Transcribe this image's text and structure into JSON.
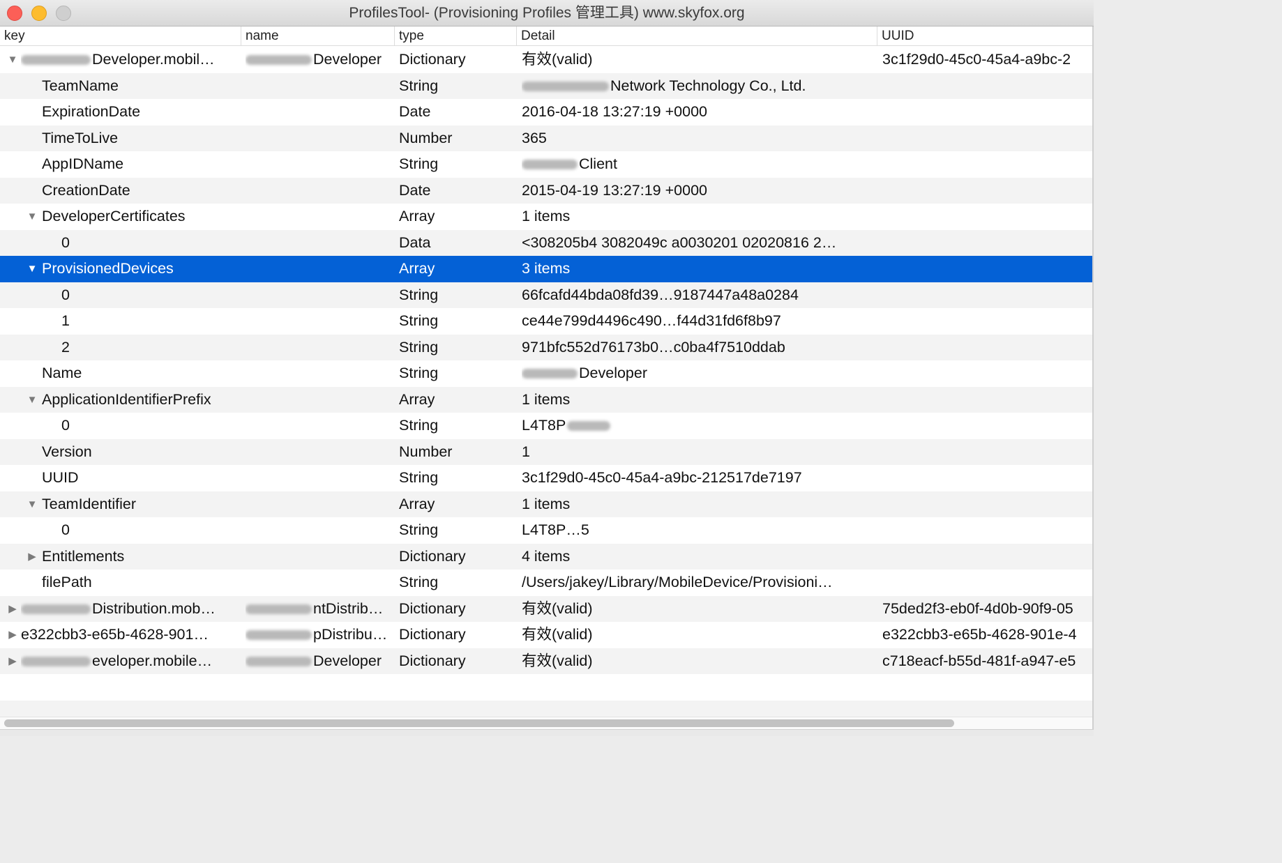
{
  "window": {
    "title": "ProfilesTool- (Provisioning Profiles 管理工具) www.skyfox.org"
  },
  "columns": [
    "key",
    "name",
    "type",
    "Detail",
    "UUID"
  ],
  "rows": [
    {
      "key": "Developer.mobil…",
      "name": "Developer",
      "type": "Dictionary",
      "detail": "有效(valid)",
      "uuid": "3c1f29d0-45c0-45a4-a9bc-2",
      "level": 0,
      "disclosure": "open",
      "redact_key": true,
      "redact_name": true
    },
    {
      "key": "TeamName",
      "name": "",
      "type": "String",
      "detail": "Network Technology Co., Ltd.",
      "uuid": "",
      "level": 1,
      "disclosure": "",
      "redact_detail": true
    },
    {
      "key": "ExpirationDate",
      "name": "",
      "type": "Date",
      "detail": "2016-04-18 13:27:19 +0000",
      "uuid": "",
      "level": 1,
      "disclosure": ""
    },
    {
      "key": "TimeToLive",
      "name": "",
      "type": "Number",
      "detail": "365",
      "uuid": "",
      "level": 1,
      "disclosure": ""
    },
    {
      "key": "AppIDName",
      "name": "",
      "type": "String",
      "detail": "Client",
      "uuid": "",
      "level": 1,
      "disclosure": "",
      "redact_detail": true
    },
    {
      "key": "CreationDate",
      "name": "",
      "type": "Date",
      "detail": "2015-04-19 13:27:19 +0000",
      "uuid": "",
      "level": 1,
      "disclosure": ""
    },
    {
      "key": "DeveloperCertificates",
      "name": "",
      "type": "Array",
      "detail": "1 items",
      "uuid": "",
      "level": 1,
      "disclosure": "open"
    },
    {
      "key": "0",
      "name": "",
      "type": "Data",
      "detail": "<308205b4 3082049c a0030201 02020816 2…",
      "uuid": "",
      "level": 2,
      "disclosure": ""
    },
    {
      "key": "ProvisionedDevices",
      "name": "",
      "type": "Array",
      "detail": "3 items",
      "uuid": "",
      "level": 1,
      "disclosure": "open",
      "selected": true
    },
    {
      "key": "0",
      "name": "",
      "type": "String",
      "detail": "66fcafd44bda08fd39…9187447a48a0284",
      "uuid": "",
      "level": 2,
      "disclosure": ""
    },
    {
      "key": "1",
      "name": "",
      "type": "String",
      "detail": "ce44e799d4496c490…f44d31fd6f8b97",
      "uuid": "",
      "level": 2,
      "disclosure": ""
    },
    {
      "key": "2",
      "name": "",
      "type": "String",
      "detail": "971bfc552d76173b0…c0ba4f7510ddab",
      "uuid": "",
      "level": 2,
      "disclosure": ""
    },
    {
      "key": "Name",
      "name": "",
      "type": "String",
      "detail": "Developer",
      "uuid": "",
      "level": 1,
      "disclosure": "",
      "redact_detail": true
    },
    {
      "key": "ApplicationIdentifierPrefix",
      "name": "",
      "type": "Array",
      "detail": "1 items",
      "uuid": "",
      "level": 1,
      "disclosure": "open"
    },
    {
      "key": "0",
      "name": "",
      "type": "String",
      "detail": "L4T8P",
      "uuid": "",
      "level": 2,
      "disclosure": "",
      "redact_after": true
    },
    {
      "key": "Version",
      "name": "",
      "type": "Number",
      "detail": "1",
      "uuid": "",
      "level": 1,
      "disclosure": ""
    },
    {
      "key": "UUID",
      "name": "",
      "type": "String",
      "detail": "3c1f29d0-45c0-45a4-a9bc-212517de7197",
      "uuid": "",
      "level": 1,
      "disclosure": ""
    },
    {
      "key": "TeamIdentifier",
      "name": "",
      "type": "Array",
      "detail": "1 items",
      "uuid": "",
      "level": 1,
      "disclosure": "open"
    },
    {
      "key": "0",
      "name": "",
      "type": "String",
      "detail": "L4T8P…5",
      "uuid": "",
      "level": 2,
      "disclosure": ""
    },
    {
      "key": "Entitlements",
      "name": "",
      "type": "Dictionary",
      "detail": "4 items",
      "uuid": "",
      "level": 1,
      "disclosure": "closed"
    },
    {
      "key": "filePath",
      "name": "",
      "type": "String",
      "detail": "/Users/jakey/Library/MobileDevice/Provisioni…",
      "uuid": "",
      "level": 1,
      "disclosure": ""
    },
    {
      "key": "Distribution.mob…",
      "name": "ntDistrib…",
      "type": "Dictionary",
      "detail": "有效(valid)",
      "uuid": "75ded2f3-eb0f-4d0b-90f9-05",
      "level": 0,
      "disclosure": "closed",
      "redact_key": true,
      "redact_name": true
    },
    {
      "key": "e322cbb3-e65b-4628-901…",
      "name": "pDistribu…",
      "type": "Dictionary",
      "detail": "有效(valid)",
      "uuid": "e322cbb3-e65b-4628-901e-4",
      "level": 0,
      "disclosure": "closed",
      "redact_name": true
    },
    {
      "key": "eveloper.mobile…",
      "name": "Developer",
      "type": "Dictionary",
      "detail": "有效(valid)",
      "uuid": "c718eacf-b55d-481f-a947-e5",
      "level": 0,
      "disclosure": "closed",
      "redact_key": true,
      "redact_name": true
    }
  ]
}
